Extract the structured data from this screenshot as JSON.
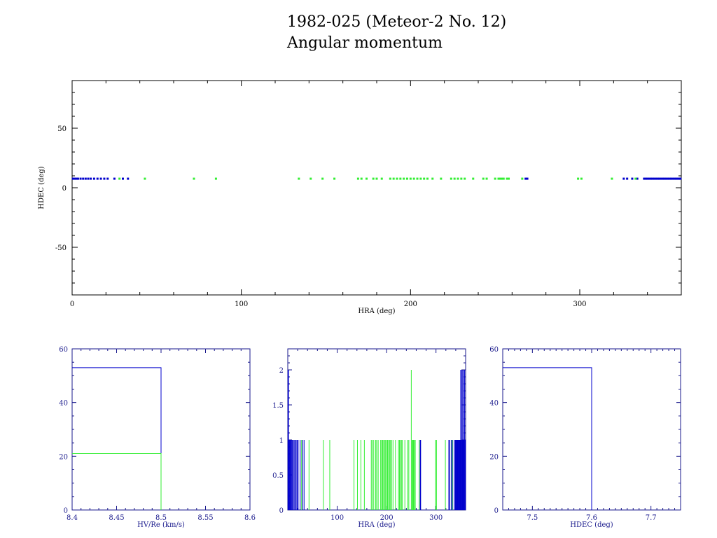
{
  "title": {
    "line1": "1982-025 (Meteor-2 No. 12)",
    "line2": "Angular momentum"
  },
  "colors": {
    "blue": "#0000cc",
    "green": "#33ee33",
    "black": "#000000",
    "axis_blue": "#1a1a8c"
  },
  "chart_data": [
    {
      "id": "scatter",
      "type": "scatter",
      "xlabel": "HRA (deg)",
      "ylabel": "HDEC (deg)",
      "xlim": [
        0,
        360
      ],
      "ylim": [
        -90,
        90
      ],
      "xticks": [
        0,
        100,
        200,
        300
      ],
      "yticks": [
        -50,
        0,
        50
      ],
      "y_value": 7.6,
      "series": [
        {
          "color": "blue",
          "x": [
            0.5,
            1.5,
            2.5,
            3.5,
            5,
            6.5,
            8,
            9.5,
            11,
            13,
            15,
            17,
            19,
            21,
            25,
            30,
            33,
            268,
            269,
            326,
            328,
            331,
            334,
            338,
            339,
            340,
            341,
            342,
            343,
            344,
            345,
            346,
            347,
            348,
            349,
            350,
            351,
            352,
            353,
            354,
            355,
            356,
            357,
            358,
            359,
            359.5
          ]
        },
        {
          "color": "green",
          "x": [
            28,
            43,
            72,
            85,
            134,
            141,
            148,
            155,
            169,
            171,
            174,
            178,
            180,
            183,
            188,
            190,
            192,
            194,
            196,
            198,
            200,
            202,
            204,
            206,
            208,
            210,
            213,
            218,
            224,
            226,
            228,
            230,
            232,
            237,
            243,
            245,
            250,
            252,
            253,
            254,
            255,
            257,
            258,
            266,
            299,
            301,
            319,
            333
          ]
        }
      ]
    },
    {
      "id": "hist-hv",
      "type": "histogram",
      "xlabel": "HV/Re (km/s)",
      "xlim": [
        8.4,
        8.6
      ],
      "ylim": [
        0,
        60
      ],
      "xticks": [
        "8.4",
        "8.45",
        "8.5",
        "8.55",
        "8.6"
      ],
      "yticks": [
        0,
        20,
        40,
        60
      ],
      "series": [
        {
          "color": "blue",
          "bin_from": 8.4,
          "bin_to": 8.5,
          "count": 53
        },
        {
          "color": "green",
          "bin_from": 8.4,
          "bin_to": 8.5,
          "count": 21
        }
      ]
    },
    {
      "id": "hist-hra",
      "type": "histogram",
      "xlabel": "HRA (deg)",
      "xlim": [
        0,
        360
      ],
      "ylim": [
        0,
        2.3
      ],
      "xticks": [
        100,
        200,
        300
      ],
      "yticks": [
        "0",
        "0.5",
        "1",
        "1.5",
        "2"
      ],
      "series": [
        {
          "color": "blue",
          "x": [
            0.5,
            1.5,
            2.5,
            3.5,
            5,
            6.5,
            8,
            9.5,
            11,
            13,
            15,
            17,
            19,
            21,
            25,
            30,
            33,
            268,
            269,
            326,
            328,
            331,
            334,
            338,
            339,
            340,
            341,
            342,
            343,
            344,
            345,
            346,
            347,
            348,
            349,
            350,
            351,
            352,
            353,
            354,
            355,
            356,
            357,
            358,
            359,
            359.5
          ],
          "counts": {
            "0.5": 2,
            "1.5": 2,
            "350": 2,
            "352": 2,
            "354": 2,
            "356": 2,
            "358": 2
          }
        },
        {
          "color": "green",
          "x": [
            28,
            43,
            72,
            85,
            134,
            141,
            148,
            155,
            169,
            171,
            174,
            178,
            180,
            183,
            188,
            190,
            192,
            194,
            196,
            198,
            200,
            202,
            204,
            206,
            208,
            210,
            213,
            218,
            224,
            226,
            228,
            230,
            232,
            237,
            243,
            245,
            250,
            252,
            253,
            254,
            255,
            257,
            258,
            266,
            299,
            301,
            319,
            333
          ],
          "counts": {
            "250": 2
          }
        }
      ]
    },
    {
      "id": "hist-hdec",
      "type": "histogram",
      "xlabel": "HDEC (deg)",
      "xlim": [
        7.45,
        7.75
      ],
      "ylim": [
        0,
        60
      ],
      "xticks": [
        "7.5",
        "7.6",
        "7.7"
      ],
      "yticks": [
        0,
        20,
        40,
        60
      ],
      "series": [
        {
          "color": "blue",
          "bin_from": 7.45,
          "bin_to": 7.6,
          "count": 53
        }
      ]
    }
  ]
}
